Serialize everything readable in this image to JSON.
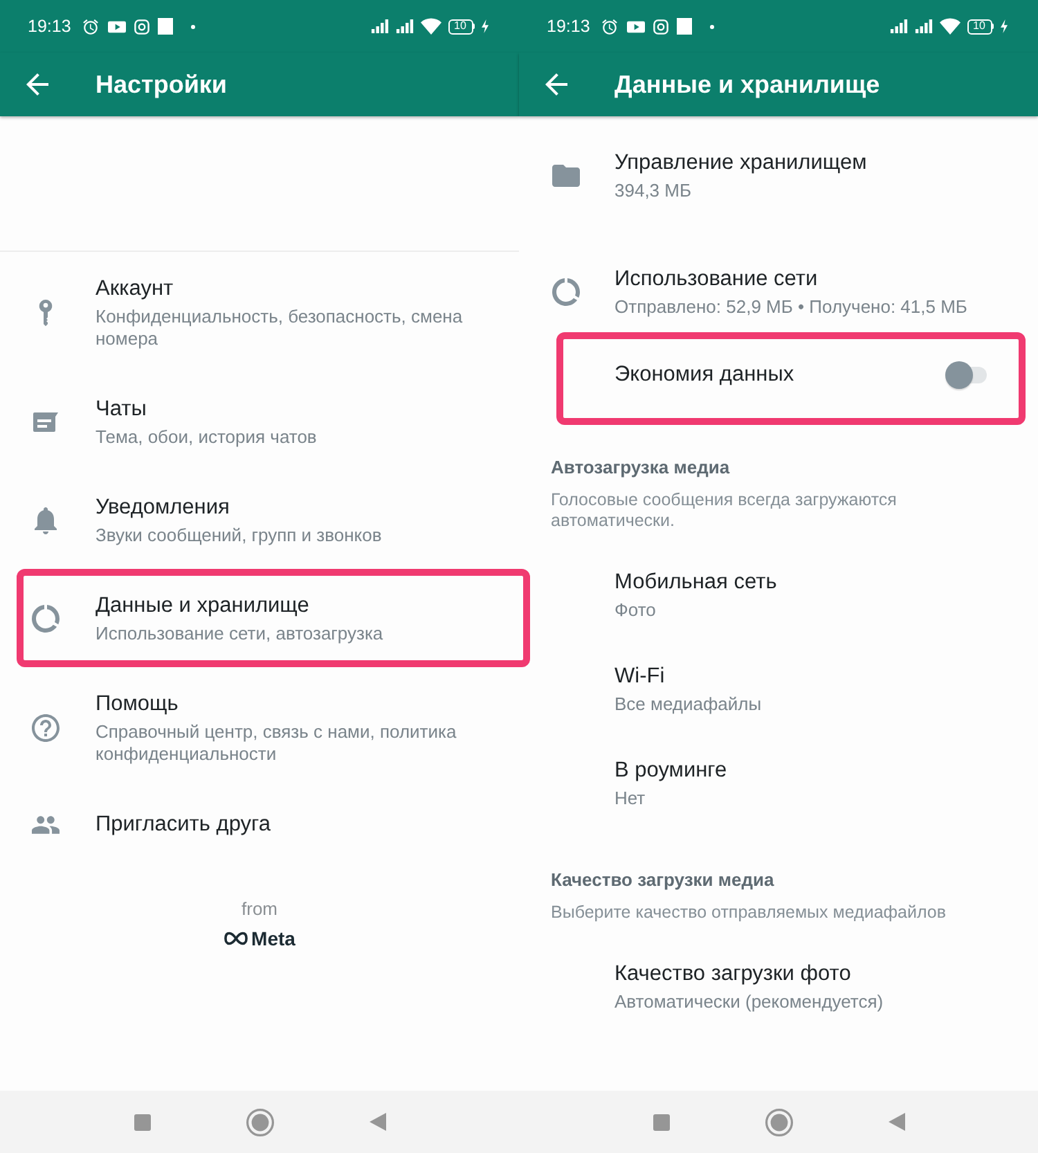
{
  "screens": [
    {
      "kind": "settings",
      "status_bar": {
        "time": "19:13",
        "battery": "10"
      },
      "title": "Настройки",
      "rows": [
        {
          "kind": "icon_item",
          "title": "Аккаунт",
          "subtitle": "Конфиденциальность, безопасность, смена номера",
          "highlighted": false
        },
        {
          "kind": "icon_item",
          "title": "Чаты",
          "subtitle": "Тема, обои, история чатов",
          "highlighted": false
        },
        {
          "kind": "icon_item",
          "title": "Уведомления",
          "subtitle": "Звуки сообщений, групп и звонков",
          "highlighted": false
        },
        {
          "kind": "icon_item",
          "title": "Данные и хранилище",
          "subtitle": "Использование сети, автозагрузка",
          "highlighted": true
        },
        {
          "kind": "icon_item",
          "title": "Помощь",
          "subtitle": "Справочный центр, связь с нами, политика конфиденциальности",
          "highlighted": false
        },
        {
          "kind": "icon_item",
          "title": "Пригласить друга",
          "highlighted": false
        }
      ],
      "footer": {
        "label": "from",
        "brand": "Meta"
      }
    },
    {
      "kind": "data_storage",
      "status_bar": {
        "time": "19:13",
        "battery": "10"
      },
      "title": "Данные и хранилище",
      "rows": [
        {
          "kind": "icon_item",
          "title": "Управление хранилищем",
          "subtitle": "394,3 МБ",
          "highlighted": false
        },
        {
          "kind": "icon_item",
          "title": "Использование сети",
          "subtitle": "Отправлено: 52,9 МБ • Получено: 41,5 МБ",
          "highlighted": false
        },
        {
          "kind": "toggle_item",
          "title": "Экономия данных",
          "on": false,
          "highlighted": true
        },
        {
          "kind": "section_header",
          "title": "Автозагрузка медиа",
          "highlighted": false
        },
        {
          "kind": "note",
          "text": "Голосовые сообщения всегда загружаются автоматически.",
          "highlighted": false
        },
        {
          "kind": "plain_item",
          "title": "Мобильная сеть",
          "subtitle": "Фото",
          "highlighted": false
        },
        {
          "kind": "plain_item",
          "title": "Wi-Fi",
          "subtitle": "Все медиафайлы",
          "highlighted": false
        },
        {
          "kind": "plain_item",
          "title": "В роуминге",
          "subtitle": "Нет",
          "highlighted": false
        },
        {
          "kind": "section_header",
          "title": "Качество загрузки медиа",
          "highlighted": false
        },
        {
          "kind": "note",
          "text": "Выберите качество отправляемых медиафайлов",
          "highlighted": false
        },
        {
          "kind": "plain_item",
          "title": "Качество загрузки фото",
          "subtitle": "Автоматически (рекомендуется)",
          "highlighted": false
        }
      ]
    }
  ]
}
